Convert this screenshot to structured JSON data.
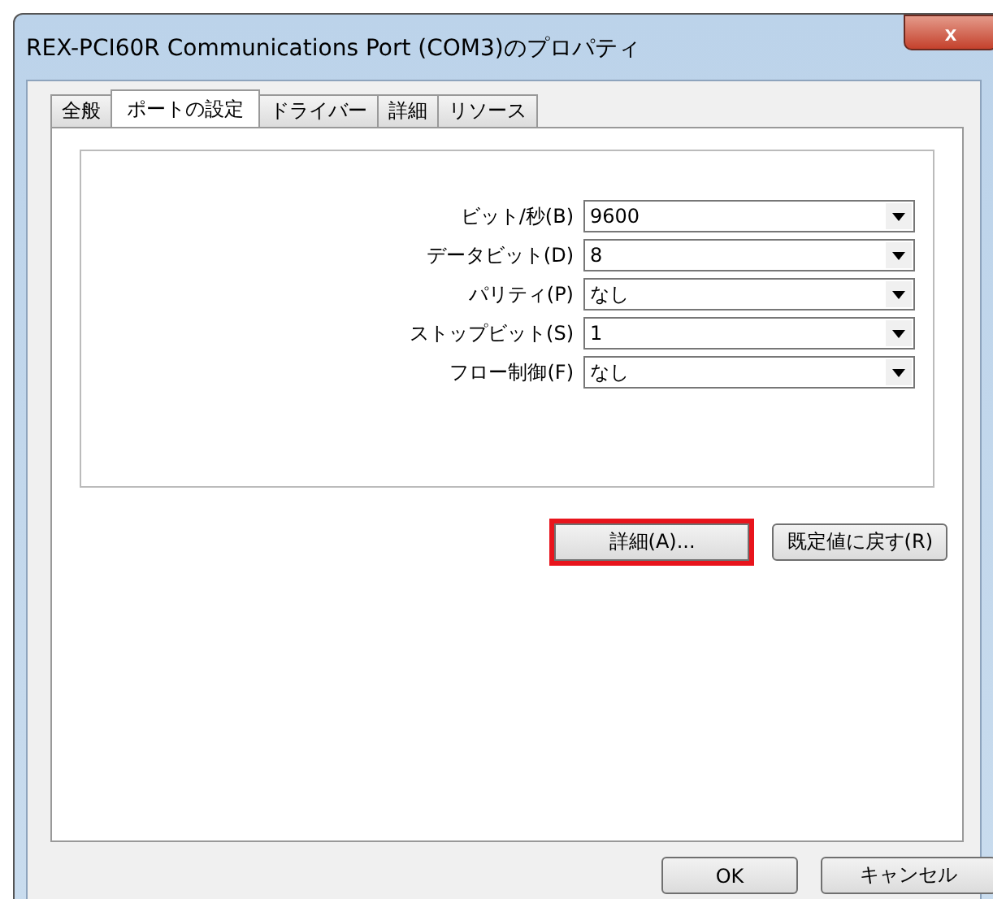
{
  "window": {
    "title": "REX-PCI60R Communications Port (COM3)のプロパティ",
    "close": "x"
  },
  "tabs": [
    {
      "label": "全般",
      "selected": false
    },
    {
      "label": "ポートの設定",
      "selected": true
    },
    {
      "label": "ドライバー",
      "selected": false
    },
    {
      "label": "詳細",
      "selected": false
    },
    {
      "label": "リソース",
      "selected": false
    }
  ],
  "settings": [
    {
      "label": "ビット/秒(B)",
      "value": "9600"
    },
    {
      "label": "データビット(D)",
      "value": "8"
    },
    {
      "label": "パリティ(P)",
      "value": "なし"
    },
    {
      "label": "ストップビット(S)",
      "value": "1"
    },
    {
      "label": "フロー制御(F)",
      "value": "なし"
    }
  ],
  "panel_buttons": [
    {
      "label": "詳細(A)...",
      "highlighted": true
    },
    {
      "label": "既定値に戻す(R)",
      "highlighted": false
    }
  ],
  "buttons": [
    "OK",
    "キャンセル"
  ]
}
